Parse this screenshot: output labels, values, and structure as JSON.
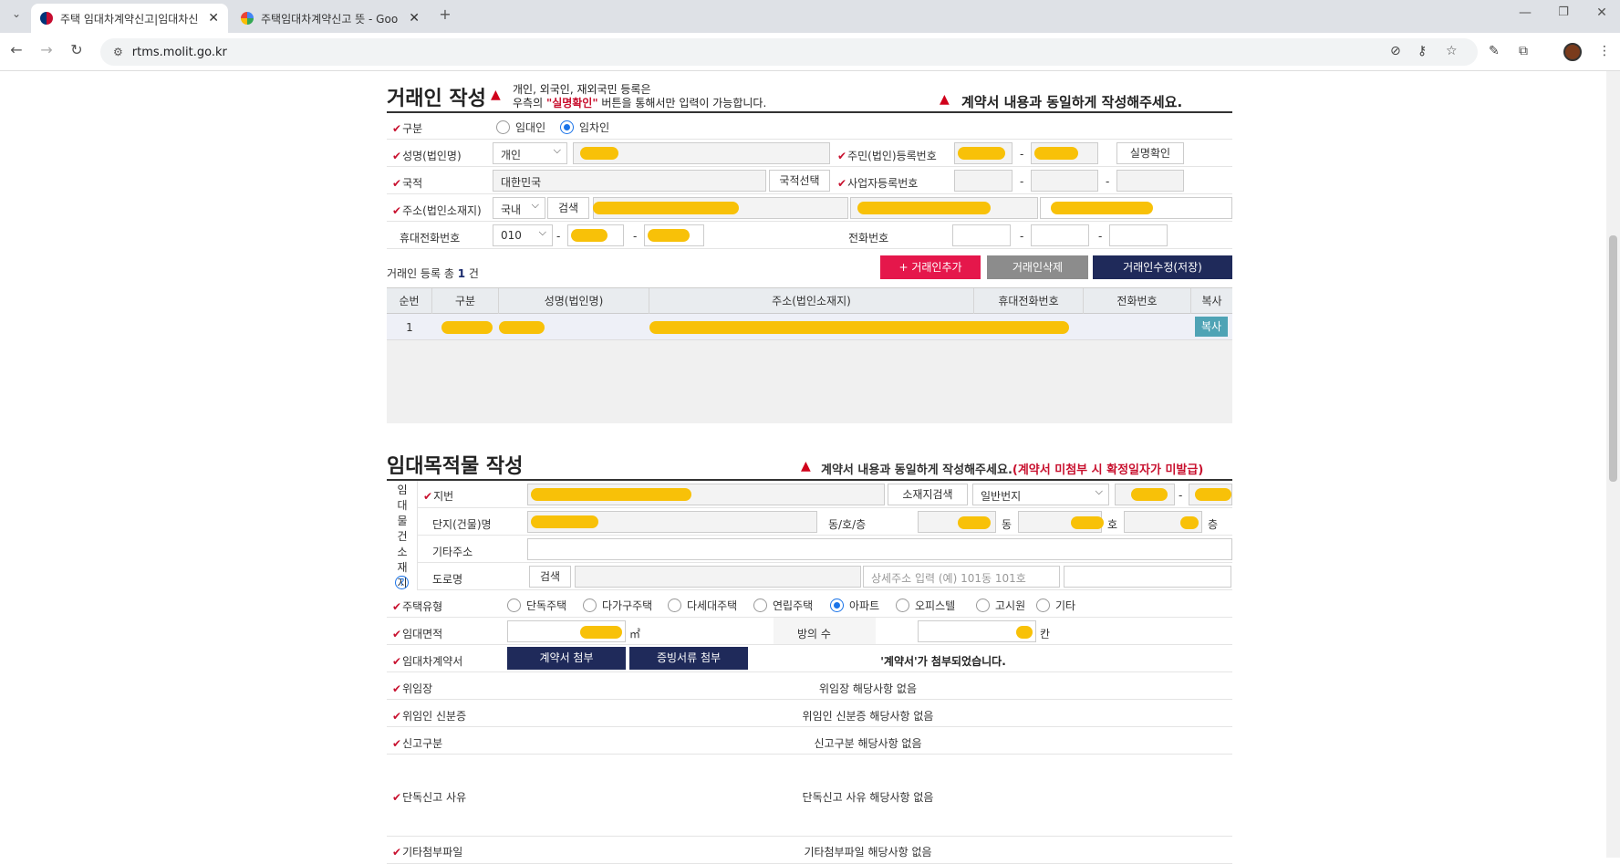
{
  "browser": {
    "tabs": [
      {
        "title": "주택 임대차계약신고|임대차신"
      },
      {
        "title": "주택임대차계약신고 뜻 - Goo"
      }
    ],
    "url": "rtms.molit.go.kr"
  },
  "party": {
    "title": "거래인 작성",
    "notice_line1": "개인, 외국인, 재외국민 등록은",
    "notice_line2a": "우측의 ",
    "notice_highlight": "\"실명확인\"",
    "notice_line2b": " 버튼을 통해서만 입력이 가능합니다.",
    "right_notice": "계약서 내용과 동일하게 작성해주세요.",
    "labels": {
      "type": "구분",
      "name": "성명(법인명)",
      "nationality": "국적",
      "address": "주소(법인소재지)",
      "mobile": "휴대전화번호",
      "resident_no": "주민(법인)등록번호",
      "business_no": "사업자등록번호",
      "phone": "전화번호"
    },
    "radio": {
      "landlord": "임대인",
      "tenant": "임차인",
      "selected": "tenant"
    },
    "name_type": "개인",
    "nationality_value": "대한민국",
    "btn_nationality": "국적선택",
    "btn_verify": "실명확인",
    "addr_scope": "국내",
    "btn_search": "검색",
    "mobile_prefix": "010",
    "dash": "-",
    "count_prefix": "거래인 등록 총 ",
    "count": "1",
    "count_suffix": " 건",
    "btn_add": "+ 거래인추가",
    "btn_delete": "거래인삭제",
    "btn_save": "거래인수정(저장)",
    "grid_headers": [
      "순번",
      "구분",
      "성명(법인명)",
      "주소(법인소재지)",
      "휴대전화번호",
      "전화번호",
      "복사"
    ],
    "grid_row_no": "1",
    "btn_copy": "복사"
  },
  "property": {
    "title": "임대목적물 작성",
    "right_notice": "계약서 내용과 동일하게 작성해주세요.",
    "right_notice_red": "(계약서 미첨부 시 확정일자가 미발급)",
    "side_label": "임대물건소재지",
    "labels": {
      "lot": "지번",
      "complex": "단지(건물)명",
      "dong_ho": "동/호/층",
      "other_addr": "기타주소",
      "road": "도로명",
      "house_type": "주택유형",
      "area": "임대면적",
      "rooms": "방의 수",
      "contract": "임대차계약서",
      "delegation": "위임장",
      "delegate_id": "위임인 신분증",
      "report_type": "신고구분",
      "sole_reason": "단독신고 사유",
      "other_files": "기타첨부파일"
    },
    "btn_addr_search": "소재지검색",
    "lot_type": "일반번지",
    "unit_dong": "동",
    "unit_ho": "호",
    "unit_floor": "층",
    "btn_road_search": "검색",
    "road_placeholder": "상세주소 입력 (예) 101동 101호",
    "house_types": [
      "단독주택",
      "다가구주택",
      "다세대주택",
      "연립주택",
      "아파트",
      "오피스텔",
      "고시원",
      "기타"
    ],
    "house_type_selected": "아파트",
    "unit_m2": "㎡",
    "unit_rooms": "칸",
    "btn_attach_contract": "계약서 첨부",
    "btn_attach_proof": "증빙서류 첨부",
    "contract_status": "'계약서'가 첨부되었습니다.",
    "delegation_status": "위임장 해당사항 없음",
    "delegate_id_status": "위임인 신분증 해당사항 없음",
    "report_type_status": "신고구분 해당사항 없음",
    "sole_reason_status": "단독신고 사유 해당사항 없음",
    "other_files_status": "기타첨부파일 해당사항 없음"
  }
}
